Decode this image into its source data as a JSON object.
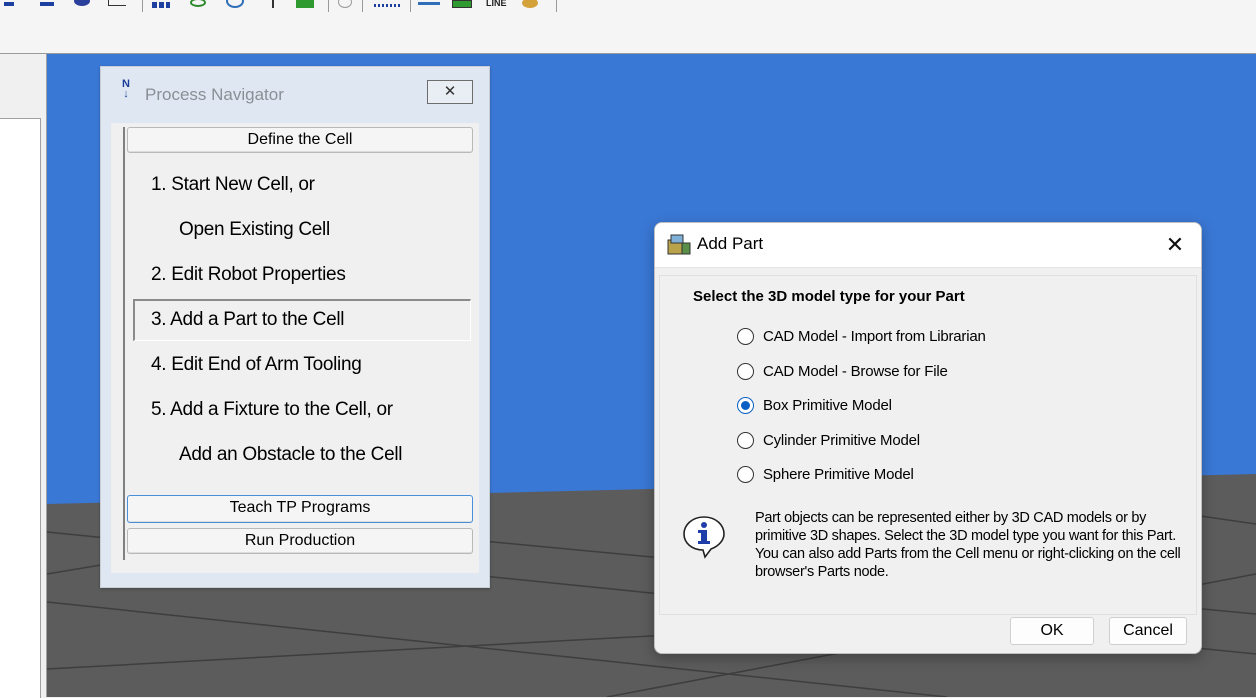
{
  "toolbar": {
    "icons": [
      "toolbar-icon",
      "toolbar-icon",
      "toolbar-icon",
      "toolbar-icon",
      "toolbar-icon",
      "toolbar-icon",
      "toolbar-icon",
      "toolbar-icon",
      "toolbar-icon",
      "toolbar-icon",
      "toolbar-icon",
      "toolbar-icon",
      "toolbar-icon",
      "toolbar-icon"
    ],
    "line_label": "LINE"
  },
  "process_navigator": {
    "title": "Process Navigator",
    "logo_text": "N",
    "close_glyph": "✕",
    "define_cell_label": "Define the Cell",
    "steps": [
      "1.  Start New Cell, or",
      "Open Existing Cell",
      "2.  Edit Robot Properties",
      "3.  Add a Part to the Cell",
      "4.  Edit End of Arm Tooling",
      "5.  Add a Fixture to the Cell, or",
      "Add an Obstacle to the Cell"
    ],
    "teach_label": "Teach TP Programs",
    "run_label": "Run Production"
  },
  "add_part_dialog": {
    "title": "Add Part",
    "close_glyph": "✕",
    "prompt": "Select the 3D model type for your Part",
    "options": [
      {
        "label": "CAD Model - Import from Librarian",
        "selected": false
      },
      {
        "label": "CAD Model - Browse for File",
        "selected": false
      },
      {
        "label": "Box Primitive Model",
        "selected": true
      },
      {
        "label": "Cylinder Primitive Model",
        "selected": false
      },
      {
        "label": "Sphere Primitive Model",
        "selected": false
      }
    ],
    "info_text": "Part objects can be represented either by 3D CAD models or by primitive 3D shapes.  Select the 3D model type you want for this Part.  You can also add Parts from the Cell menu or right-clicking on the cell browser's Parts node.",
    "ok_label": "OK",
    "cancel_label": "Cancel"
  },
  "colors": {
    "sky": "#3a78d6",
    "floor": "#5c5c5c",
    "accent": "#0a5fc4"
  }
}
